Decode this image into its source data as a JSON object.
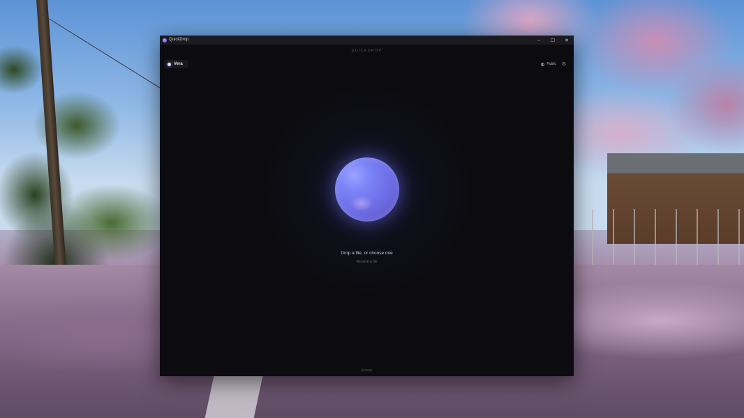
{
  "window": {
    "title": "QuickDrop",
    "controls": {
      "minimize": "–",
      "maximize": "☐",
      "close": "✕"
    }
  },
  "app": {
    "brand": "QUICKDROP",
    "user": {
      "name": "Vera"
    },
    "visibility": {
      "label": "Public",
      "icon": "globe-icon"
    },
    "settings_icon": "gear-icon",
    "drop_prompt": "Drop a file, or choose one",
    "receive_link": "Receive a file",
    "activity_label": "Activity"
  },
  "colors": {
    "accent": "#6e6ee6",
    "background": "#0c0c10",
    "titlebar": "#1b1b1f"
  }
}
